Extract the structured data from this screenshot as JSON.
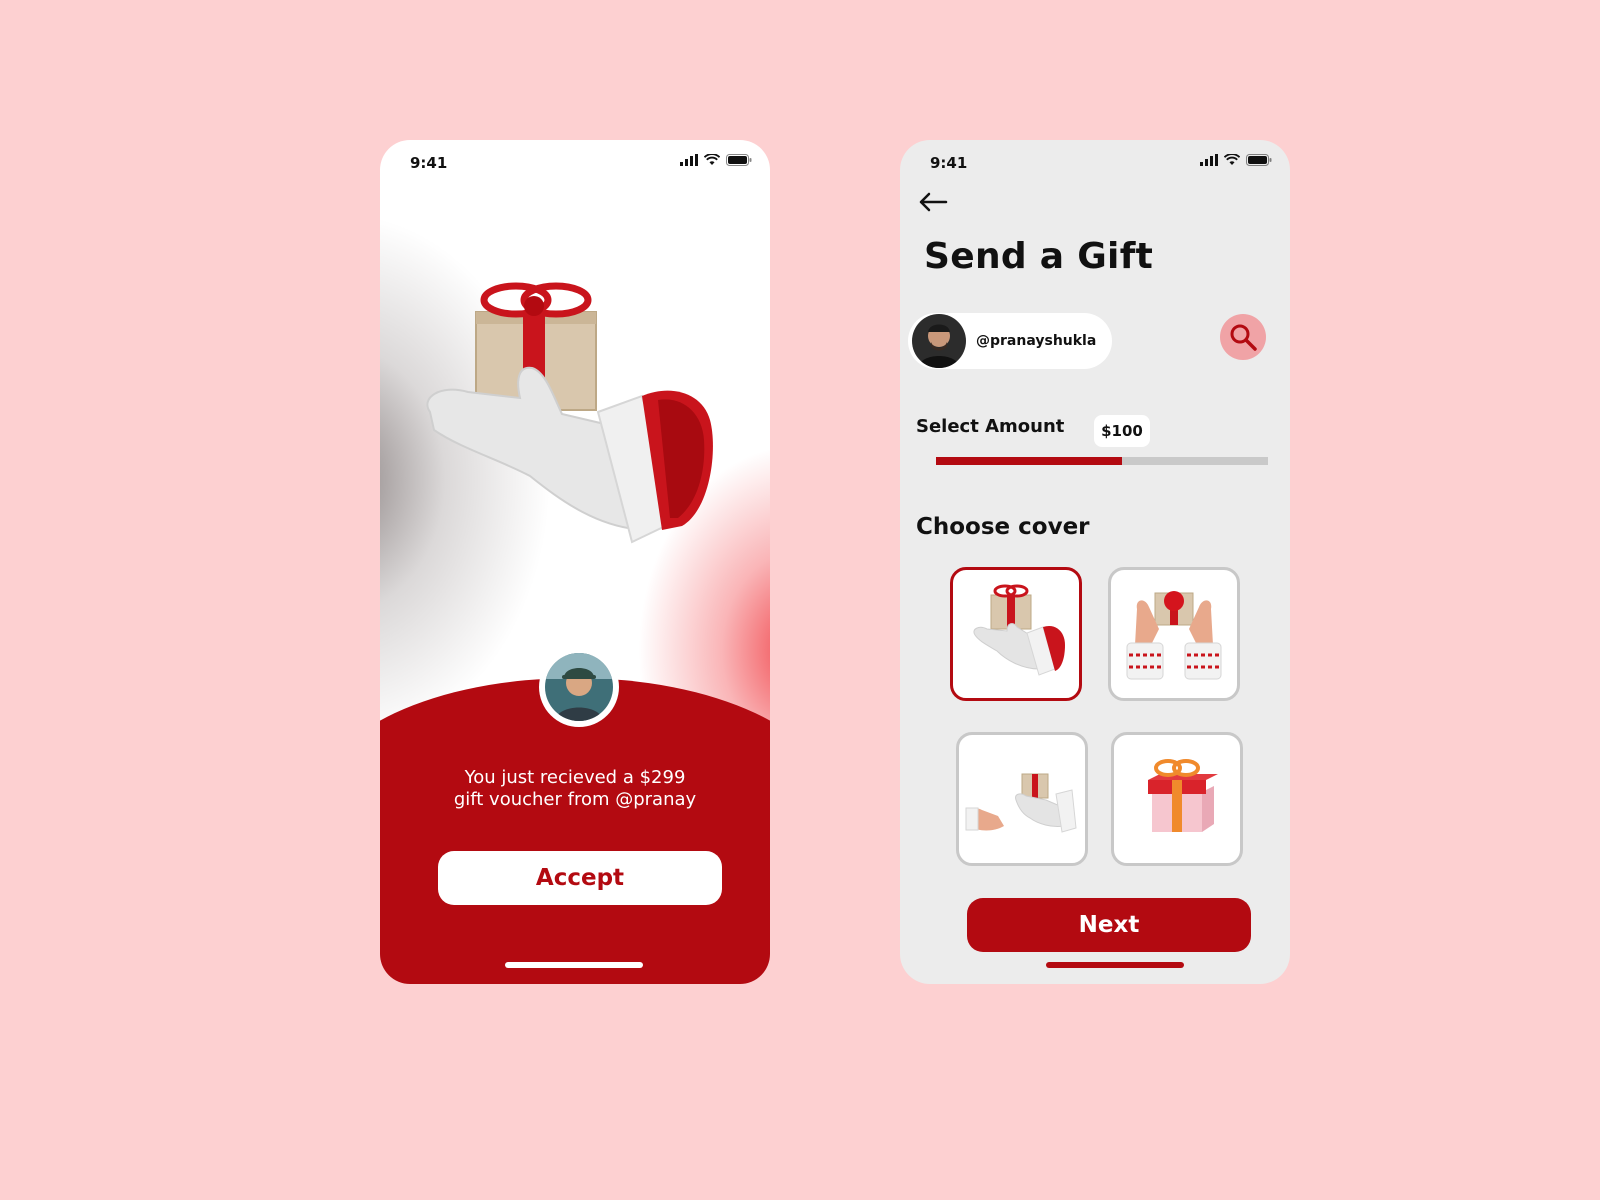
{
  "theme": {
    "background": "#fdd0d1",
    "accent": "#b30a11",
    "search_bg": "#f0a3a6"
  },
  "left_screen": {
    "status": {
      "time": "9:41",
      "icons": [
        "signal-icon",
        "wifi-icon",
        "battery-icon"
      ]
    },
    "hero_image": "santa-glove-holding-gift",
    "sender_avatar": "sender-avatar-photo",
    "message": {
      "line1": "You just recieved a $299",
      "line2": "gift voucher from @pranay"
    },
    "accept_label": "Accept"
  },
  "right_screen": {
    "status": {
      "time": "9:41",
      "icons": [
        "signal-icon",
        "wifi-icon",
        "battery-icon"
      ]
    },
    "back_icon": "arrow-left-icon",
    "title": "Send a Gift",
    "recipient": {
      "handle": "@pranayshukla",
      "avatar": "recipient-avatar-photo"
    },
    "search_icon": "search-icon",
    "amount": {
      "label": "Select Amount",
      "value": "$100",
      "slider_fraction": 0.56
    },
    "cover_label": "Choose cover",
    "covers": [
      {
        "image": "glove-holding-gift",
        "selected": true
      },
      {
        "image": "hands-holding-gift",
        "selected": false
      },
      {
        "image": "hand-passing-gift",
        "selected": false
      },
      {
        "image": "gift-box",
        "selected": false
      }
    ],
    "next_label": "Next"
  }
}
